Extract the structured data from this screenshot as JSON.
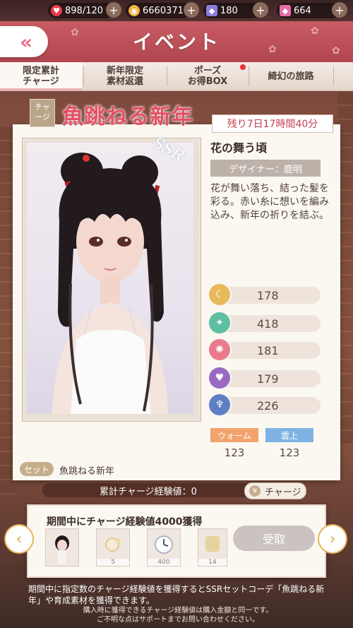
{
  "top_bar": {
    "stamina": "898/120",
    "coins": "6660371",
    "diamonds": "180",
    "pink_diamonds": "664"
  },
  "header": {
    "title": "イベント"
  },
  "tabs": [
    {
      "line1": "限定累計",
      "line2": "チャージ"
    },
    {
      "line1": "新年限定",
      "line2": "素材返還"
    },
    {
      "line1": "ポーズ",
      "line2": "お得BOX"
    },
    {
      "line1": "綺幻の旅路",
      "line2": ""
    }
  ],
  "event": {
    "tag_line1": "チャ",
    "tag_line2": "ージ",
    "title": "魚跳ねる新年",
    "remaining": "残り7日17時間40分"
  },
  "item": {
    "rarity": "SSR",
    "name": "花の舞う頃",
    "designer": "デザイナー：鹿明",
    "description": "花が舞い落ち、結った髪を彩る。赤い糸に想いを編み込み、新年の祈りを結ぶ。",
    "stats": [
      {
        "icon": "elegant-icon",
        "value": "178",
        "color": "#e8b95a"
      },
      {
        "icon": "fresh-icon",
        "value": "418",
        "color": "#5fbfa2"
      },
      {
        "icon": "sweet-icon",
        "value": "181",
        "color": "#ea7a8c"
      },
      {
        "icon": "sexy-icon",
        "value": "179",
        "color": "#9a6ac2"
      },
      {
        "icon": "cool-icon",
        "value": "226",
        "color": "#5e7fc6"
      }
    ],
    "tags": [
      {
        "label": "ウォーム",
        "value": "123",
        "color": "#f2a36d"
      },
      {
        "label": "雲上",
        "value": "123",
        "color": "#7fb2e3"
      }
    ],
    "set_badge": "セット",
    "set_name": "魚跳ねる新年"
  },
  "exp": {
    "text": "累計チャージ経験値：0",
    "charge_button": "チャージ"
  },
  "reward": {
    "title": "期間中にチャージ経験値4000獲得",
    "thumbs": [
      "",
      "5",
      "400",
      "14"
    ],
    "claim_button": "受取"
  },
  "notes": {
    "main": "期間中に指定数のチャージ経験値を獲得するとSSRセットコーデ「魚跳ねる新年」や育成素材を獲得できます。",
    "sub1": "購入時に獲得できるチャージ経験値は購入金額と同一です。",
    "sub2": "ご不明な点はサポートまでお問い合わせください。"
  }
}
